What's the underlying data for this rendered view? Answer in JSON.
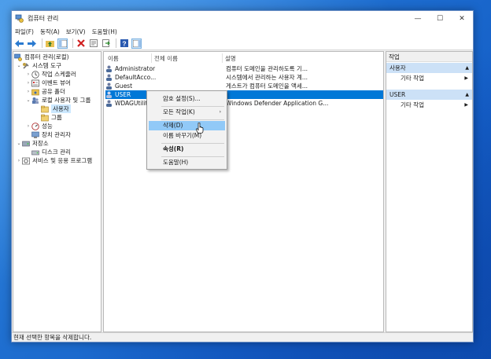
{
  "window": {
    "title": "컴퓨터 관리"
  },
  "menubar": [
    "파일(F)",
    "동작(A)",
    "보기(V)",
    "도움말(H)"
  ],
  "tree": {
    "root": "컴퓨터 관리(로컬)",
    "system_tools": "시스템 도구",
    "task_scheduler": "작업 스케줄러",
    "event_viewer": "이벤트 뷰어",
    "shared_folders": "공유 폴더",
    "local_users": "로컬 사용자 및 그룹",
    "users": "사용자",
    "groups": "그룹",
    "performance": "성능",
    "device_manager": "장치 관리자",
    "storage": "저장소",
    "disk_management": "디스크 관리",
    "services": "서비스 및 응용 프로그램"
  },
  "list": {
    "columns": {
      "name": "이름",
      "full_name": "전체 이름",
      "description": "설명"
    },
    "rows": [
      {
        "name": "Administrator",
        "description": "컴퓨터 도메인을 관리하도록 기..."
      },
      {
        "name": "DefaultAcco...",
        "description": "시스템에서 관리하는 사용자 계..."
      },
      {
        "name": "Guest",
        "description": "게스트가 컴퓨터 도메인을 액세..."
      },
      {
        "name": "USER",
        "description": ""
      },
      {
        "name": "WDAGUtility",
        "description": "Windows Defender Application G..."
      }
    ]
  },
  "context_menu": {
    "set_password": "암호 설정(S)...",
    "all_tasks": "모든 작업(K)",
    "delete": "삭제(D)",
    "rename": "이름 바꾸기(M)",
    "properties": "속성(R)",
    "help": "도움말(H)"
  },
  "actions": {
    "header": "작업",
    "section1": "사용자",
    "section1_more": "기타 작업",
    "section2": "USER",
    "section2_more": "기타 작업"
  },
  "status": "현재 선택한 항목을 삭제합니다.",
  "colors": {
    "selection": "#0078d7",
    "hover": "#91c9f7",
    "action_section": "#cce1f7"
  }
}
